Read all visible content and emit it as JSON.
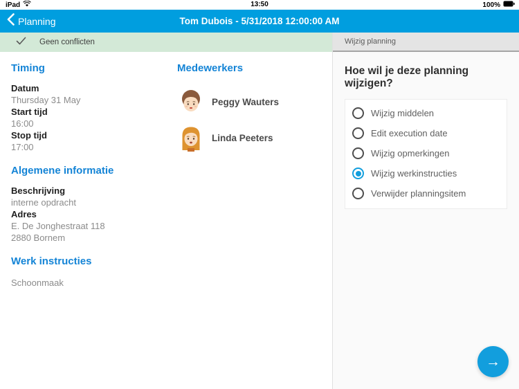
{
  "status_bar": {
    "device": "iPad",
    "time": "13:50",
    "battery": "100%"
  },
  "nav_bar": {
    "back_label": "Planning",
    "title": "Tom Dubois - 5/31/2018 12:00:00 AM"
  },
  "banner": {
    "text": "Geen conflicten",
    "check_icon": "✓"
  },
  "details": {
    "sections": [
      {
        "heading": "Timing",
        "fields": [
          {
            "label": "Datum",
            "value1": "Thursday 31 May"
          },
          {
            "label": "Start tijd",
            "value1": "16:00"
          },
          {
            "label": "Stop tijd",
            "value1": "17:00"
          }
        ]
      },
      {
        "heading": "Algemene informatie",
        "fields": [
          {
            "label": "Beschrijving",
            "value1": "interne opdracht"
          },
          {
            "label": "Adres",
            "value1": "E. De Jonghestraat 118",
            "value2": "2880 Bornem"
          }
        ]
      },
      {
        "heading": "Werk instructies",
        "value": "Schoonmaak"
      }
    ]
  },
  "medewerkers": {
    "heading": "Medewerkers",
    "people": [
      {
        "name": "Peggy Wauters"
      },
      {
        "name": "Linda Peeters"
      }
    ]
  },
  "panel": {
    "header": "Wijzig planning",
    "question": "Hoe wil je deze planning wijzigen?",
    "options": [
      {
        "label": "Wijzig middelen",
        "selected": false
      },
      {
        "label": "Edit execution date",
        "selected": false
      },
      {
        "label": "Wijzig opmerkingen",
        "selected": false
      },
      {
        "label": "Wijzig werkinstructies",
        "selected": true
      },
      {
        "label": "Verwijder planningsitem",
        "selected": false
      }
    ],
    "fab_icon": "→"
  },
  "colors": {
    "nav_bar": "#009edf",
    "accent_blue": "#1484d6",
    "banner_green": "#d3e9d7",
    "radio_selected": "#129edd",
    "fab": "#129edd"
  }
}
